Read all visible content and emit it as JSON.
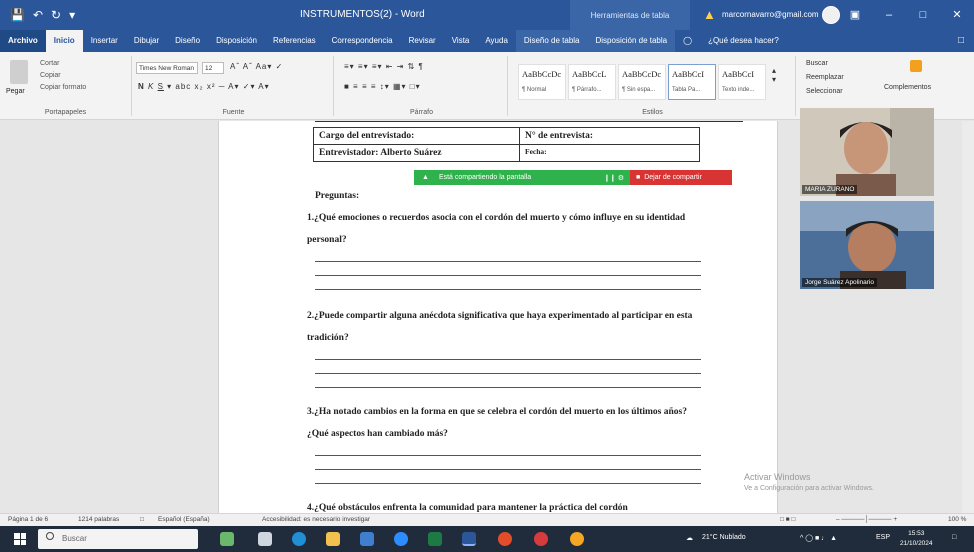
{
  "window": {
    "title": "INSTRUMENTOS(2) - Word",
    "context_label": "Herramientas de tabla",
    "user_email": "marcornavarro@gmail.com"
  },
  "menu": {
    "items": [
      "Archivo",
      "Inicio",
      "Insertar",
      "Dibujar",
      "Diseño",
      "Disposición",
      "Referencias",
      "Correspondencia",
      "Revisar",
      "Vista",
      "Ayuda",
      "Diseño de tabla",
      "Disposición de tabla"
    ],
    "active": "Inicio",
    "tell_me": "¿Qué desea hacer?"
  },
  "ribbon": {
    "clipboard": {
      "paste": "Pegar",
      "cut": "Cortar",
      "copy": "Copiar",
      "format_painter": "Copiar formato",
      "group_label": "Portapapeles"
    },
    "font": {
      "family": "Times New Roman",
      "size": "12",
      "group_label": "Fuente"
    },
    "paragraph": {
      "group_label": "Párrafo"
    },
    "styles": {
      "group_label": "Estilos",
      "tiles": [
        {
          "sample": "AaBbCcDc",
          "name": "¶ Normal"
        },
        {
          "sample": "AaBbCcL",
          "name": "¶ Párrafo..."
        },
        {
          "sample": "AaBbCcDc",
          "name": "¶ Sin espa..."
        },
        {
          "sample": "AaBbCcI",
          "name": "Tabla Pa..."
        },
        {
          "sample": "AaBbCcI",
          "name": "Texto inde..."
        }
      ]
    },
    "editing": {
      "find": "Buscar",
      "replace": "Reemplazar",
      "select": "Seleccionar"
    },
    "complements": "Complementos"
  },
  "document": {
    "table": {
      "row1": {
        "left": "Cargo del entrevistado:",
        "right": "N° de entrevista:"
      },
      "row2": {
        "left": "Entrevistador: Alberto Suárez",
        "right": "Fecha:"
      }
    },
    "heading": "Preguntas:",
    "questions": [
      "1.¿Qué emociones o recuerdos asocia con el cordón del muerto y cómo influye en su identidad personal?",
      "2.¿Puede compartir alguna anécdota significativa que haya experimentado al participar en esta tradición?",
      "3.¿Ha notado cambios en la forma en que se celebra el cordón del muerto en los últimos años? ¿Qué aspectos han cambiado más?",
      "4.¿Qué obstáculos enfrenta la comunidad para mantener la práctica del cordón"
    ]
  },
  "share_bar": {
    "status": "Está compartiendo la pantalla",
    "stop": "Dejar de compartir"
  },
  "participants": [
    {
      "name": "MARIA ZURANO"
    },
    {
      "name": "Jorge Suárez Apolinario"
    }
  ],
  "activation": {
    "title": "Activar Windows",
    "subtitle": "Ve a Configuración para activar Windows."
  },
  "status_bar": {
    "page": "Página 1 de 6",
    "words": "1214 palabras",
    "language": "Español (España)",
    "accessibility": "Accesibilidad: es necesario investigar",
    "zoom": "100 %"
  },
  "taskbar": {
    "search_placeholder": "Buscar",
    "weather": "21°C Nublado",
    "language": "ESP",
    "time": "15:53",
    "date": "21/10/2024"
  }
}
